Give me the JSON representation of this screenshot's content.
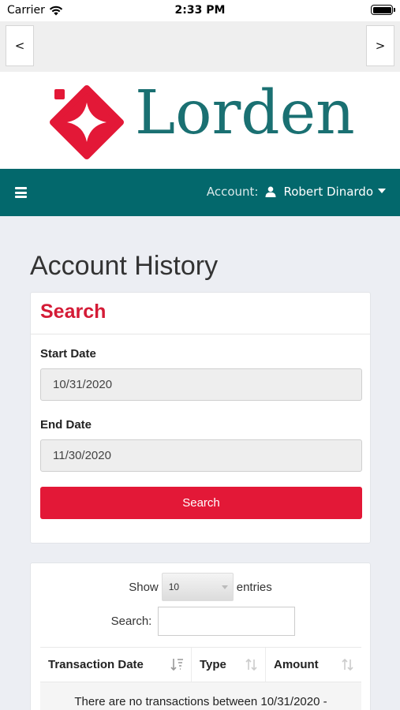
{
  "status_bar": {
    "carrier": "Carrier",
    "time": "2:33 PM"
  },
  "browser_nav": {
    "back_label": "<",
    "forward_label": ">"
  },
  "brand": {
    "name": "Lorden",
    "primary_color": "#1a7072",
    "accent_color": "#e31837"
  },
  "top_nav": {
    "menu_icon": "hamburger-icon",
    "account_label": "Account:",
    "user_icon": "user-icon",
    "user_name": "Robert Dinardo",
    "bg_color": "#03686c"
  },
  "page": {
    "title": "Account History"
  },
  "search_card": {
    "heading": "Search",
    "start_label": "Start Date",
    "start_value": "10/31/2020",
    "end_label": "End Date",
    "end_value": "11/30/2020",
    "button_label": "Search"
  },
  "table_card": {
    "show_label": "Show",
    "entries_value": "10",
    "entries_label": "entries",
    "search_label": "Search:",
    "search_value": "",
    "columns": [
      "Transaction Date",
      "Type",
      "Amount"
    ],
    "empty_message": "There are no transactions between 10/31/2020 -"
  }
}
